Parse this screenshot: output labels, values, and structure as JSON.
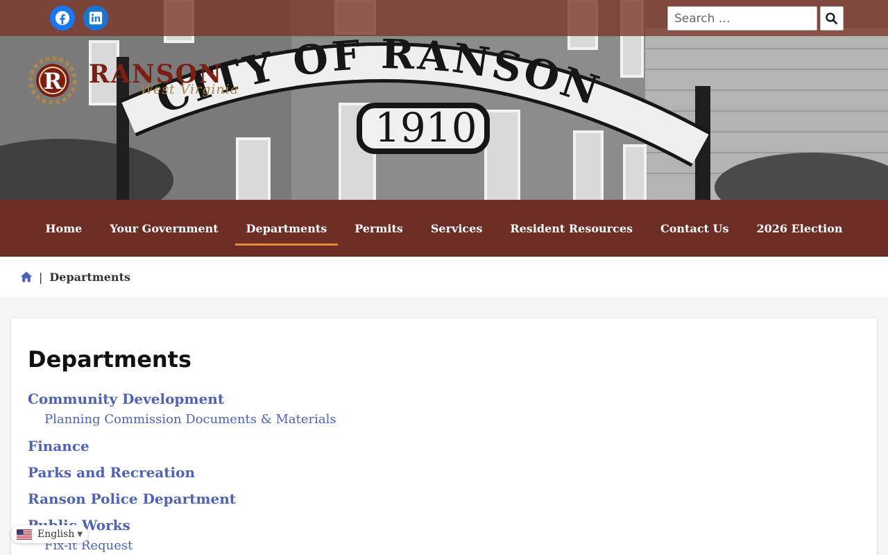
{
  "header": {
    "search_placeholder": "Search …",
    "logo": {
      "word": "RANSON",
      "sub": "West Virginia"
    },
    "sign": {
      "title": "CITY OF RANSON",
      "year": "1910"
    }
  },
  "social": [
    "facebook-icon",
    "linkedin-icon"
  ],
  "nav": {
    "items": [
      "Home",
      "Your Government",
      "Departments",
      "Permits",
      "Services",
      "Resident Resources",
      "Contact Us",
      "2026 Election"
    ],
    "active": "Departments"
  },
  "breadcrumb": {
    "current": "Departments",
    "separator": "|"
  },
  "main": {
    "title": "Departments",
    "departments": [
      {
        "label": "Community Development",
        "children": [
          "Planning Commission Documents & Materials"
        ]
      },
      {
        "label": "Finance",
        "children": []
      },
      {
        "label": "Parks and Recreation",
        "children": []
      },
      {
        "label": "Ranson Police Department",
        "children": []
      },
      {
        "label": "Public Works",
        "children": [
          "Fix-it Request"
        ]
      }
    ]
  },
  "language": {
    "label": "English"
  },
  "colors": {
    "nav_bg": "#6c2e24",
    "accent_underline": "#e88a3c",
    "link": "#4f62b5",
    "facebook": "#1877f2"
  }
}
